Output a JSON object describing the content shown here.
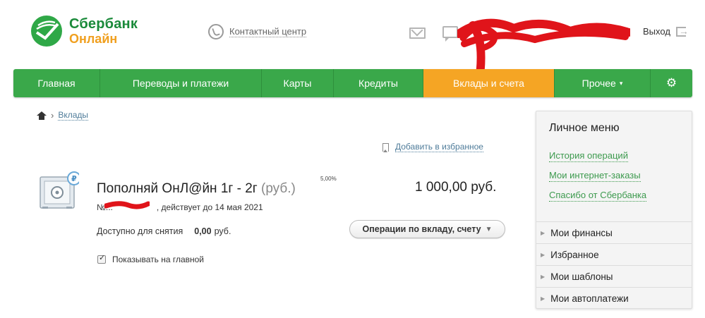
{
  "header": {
    "logo_line1": "Сбербанк",
    "logo_line2": "Онлайн",
    "contact_label": "Контактный центр",
    "logout_label": "Выход",
    "icons": [
      "phone-icon",
      "mail-icon",
      "chat-icon",
      "logout-icon"
    ]
  },
  "nav": {
    "items": [
      {
        "label": "Главная"
      },
      {
        "label": "Переводы и платежи"
      },
      {
        "label": "Карты"
      },
      {
        "label": "Кредиты"
      },
      {
        "label": "Вклады и счета"
      },
      {
        "label": "Прочее"
      }
    ],
    "active_index": 4,
    "settings_icon": "gear-icon",
    "other_caret": "▾",
    "colors": {
      "bar": "#3aa84a",
      "active": "#f5a524"
    }
  },
  "breadcrumb": {
    "current": "Вклады"
  },
  "favorite": {
    "label": "Добавить в избранное"
  },
  "deposit": {
    "title": "Пополняй ОнЛ@йн 1г - 2г",
    "currency_suffix": "(руб.)",
    "rate": "5,00%",
    "amount": "1 000,00 руб.",
    "number_prefix": "№...",
    "number_suffix": ", действует до 14 мая 2021",
    "available_label": "Доступно для снятия",
    "available_value": "0,00",
    "available_unit": "руб.",
    "operations_button": "Операции по вкладу, счету",
    "show_on_main_label": "Показывать на главной",
    "show_on_main_checked": true
  },
  "side_menu": {
    "title": "Личное меню",
    "links": [
      {
        "label": "История операций"
      },
      {
        "label": "Мои интернет-заказы"
      },
      {
        "label": "Спасибо от Сбербанка"
      }
    ],
    "sections": [
      {
        "label": "Мои финансы"
      },
      {
        "label": "Избранное"
      },
      {
        "label": "Мои шаблоны"
      },
      {
        "label": "Мои автоплатежи"
      }
    ]
  }
}
